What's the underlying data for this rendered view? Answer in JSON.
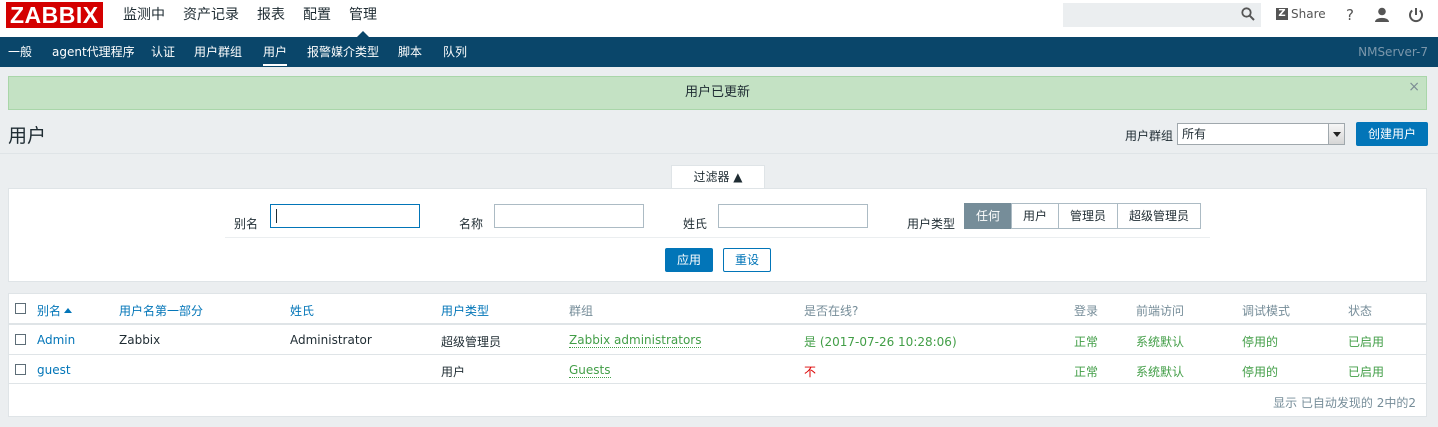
{
  "topbar": {
    "logo": "ZABBIX",
    "menu": [
      "监测中",
      "资产记录",
      "报表",
      "配置",
      "管理"
    ],
    "share": "Share",
    "help": "?"
  },
  "subnav": {
    "items": [
      "一般",
      "agent代理程序",
      "认证",
      "用户群组",
      "用户",
      "报警媒介类型",
      "脚本",
      "队列"
    ],
    "server": "NMServer-7"
  },
  "message": {
    "text": "用户已更新",
    "close": "×"
  },
  "page": {
    "title": "用户",
    "group_label": "用户群组",
    "group_value": "所有",
    "create_button": "创建用户"
  },
  "filter": {
    "tab_label": "过滤器 ▲",
    "alias_label": "别名",
    "alias_value": "",
    "name_label": "名称",
    "name_value": "",
    "surname_label": "姓氏",
    "surname_value": "",
    "type_label": "用户类型",
    "type_options": [
      "任何",
      "用户",
      "管理员",
      "超级管理员"
    ],
    "apply": "应用",
    "reset": "重设"
  },
  "table": {
    "headers": [
      "别名",
      "用户名第一部分",
      "姓氏",
      "用户类型",
      "群组",
      "是否在线?",
      "登录",
      "前端访问",
      "调试模式",
      "状态"
    ],
    "rows": [
      {
        "alias": "Admin",
        "name": "Zabbix",
        "surname": "Administrator",
        "type": "超级管理员",
        "groups": "Zabbix administrators",
        "online": "是 (2017-07-26 10:28:06)",
        "login": "正常",
        "frontend": "系统默认",
        "debug": "停用的",
        "status": "已启用"
      },
      {
        "alias": "guest",
        "name": "",
        "surname": "",
        "type": "用户",
        "groups": "Guests",
        "online": "不",
        "login": "正常",
        "frontend": "系统默认",
        "debug": "停用的",
        "status": "已启用"
      }
    ],
    "footer": "显示 已自动发现的 2中的2"
  }
}
